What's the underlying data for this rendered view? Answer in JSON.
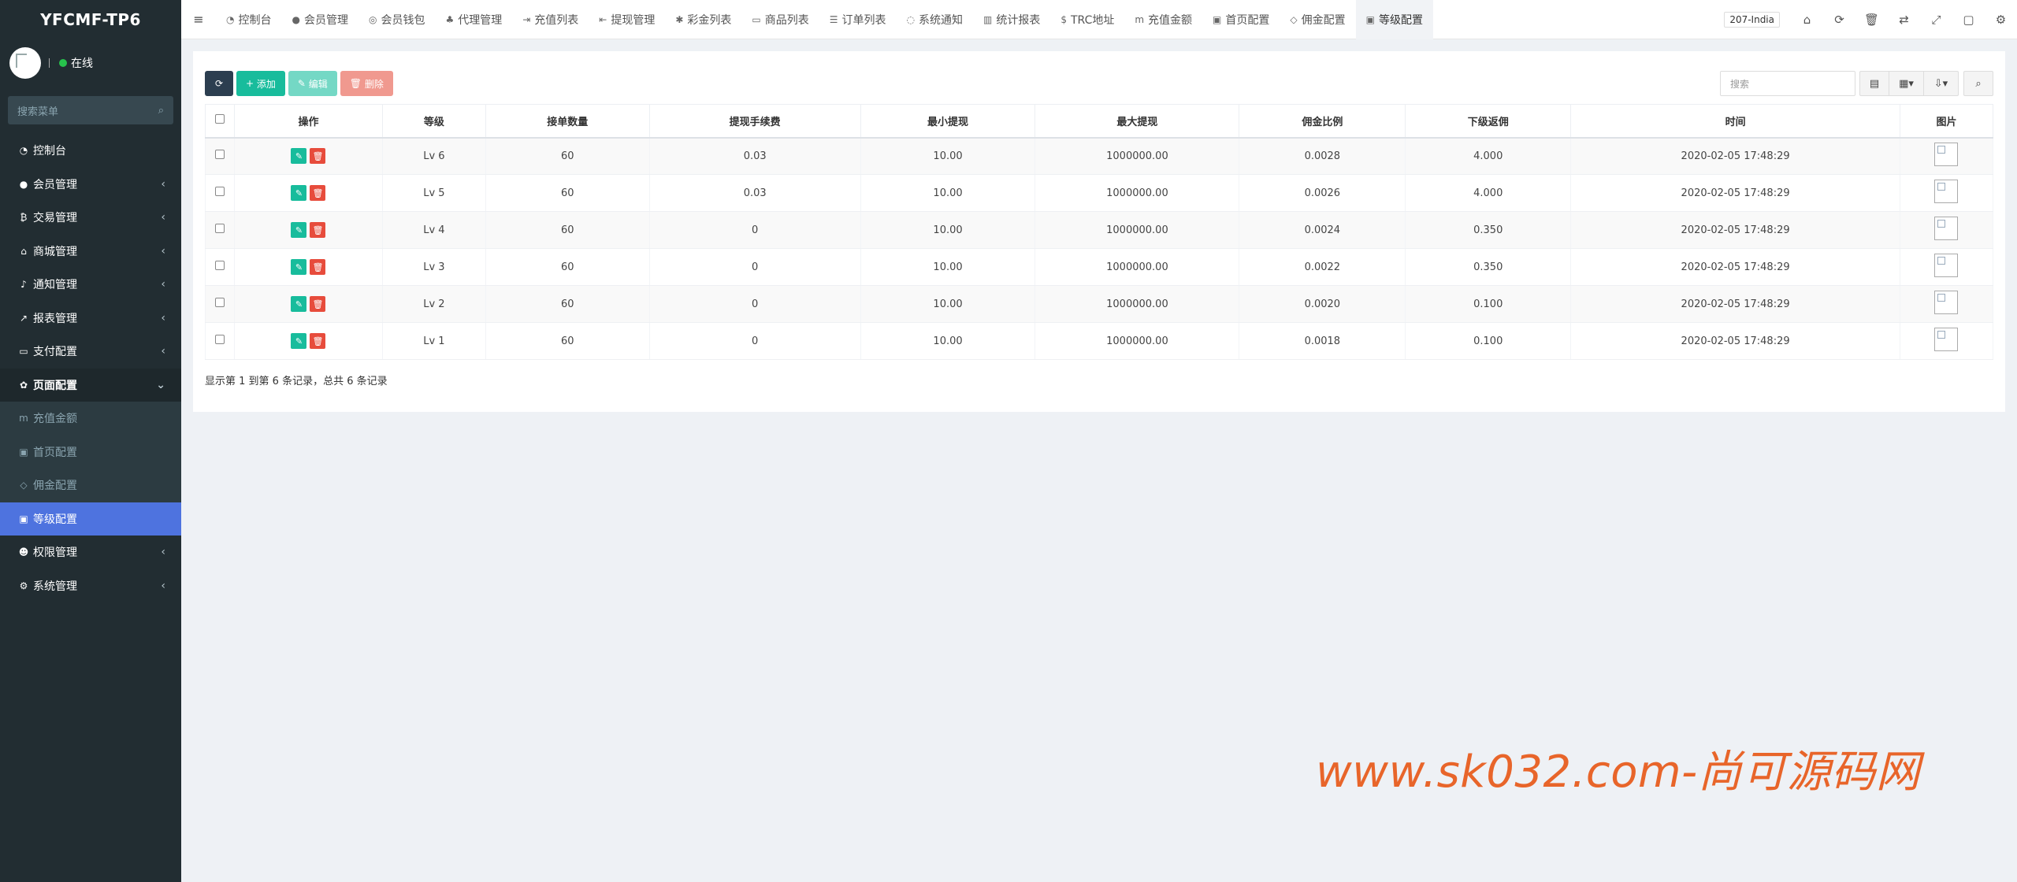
{
  "brand": "YFCMF-TP6",
  "user": {
    "status": "在线"
  },
  "sidebar": {
    "search_placeholder": "搜索菜单",
    "items": [
      {
        "label": "控制台",
        "icon": "dashboard-icon",
        "glyph": "◔",
        "chevron": ""
      },
      {
        "label": "会员管理",
        "icon": "user-circle-icon",
        "glyph": "●",
        "chevron": "‹"
      },
      {
        "label": "交易管理",
        "icon": "bitcoin-icon",
        "glyph": "₿",
        "chevron": "‹"
      },
      {
        "label": "商城管理",
        "icon": "home-icon",
        "glyph": "⌂",
        "chevron": "‹"
      },
      {
        "label": "通知管理",
        "icon": "bell-icon",
        "glyph": "♪",
        "chevron": "‹"
      },
      {
        "label": "报表管理",
        "icon": "line-chart-icon",
        "glyph": "↗",
        "chevron": "‹"
      },
      {
        "label": "支付配置",
        "icon": "credit-card-icon",
        "glyph": "▭",
        "chevron": "‹"
      },
      {
        "label": "页面配置",
        "icon": "gear-icon",
        "glyph": "✿",
        "chevron": "⌄"
      },
      {
        "label": "充值金额",
        "icon": "m-icon",
        "glyph": "m",
        "chevron": ""
      },
      {
        "label": "首页配置",
        "icon": "window-icon",
        "glyph": "▣",
        "chevron": ""
      },
      {
        "label": "佣金配置",
        "icon": "diamond-icon",
        "glyph": "◇",
        "chevron": ""
      },
      {
        "label": "等级配置",
        "icon": "vimeo-icon",
        "glyph": "▣",
        "chevron": ""
      },
      {
        "label": "权限管理",
        "icon": "users-icon",
        "glyph": "☻",
        "chevron": "‹"
      },
      {
        "label": "系统管理",
        "icon": "cogs-icon",
        "glyph": "⚙",
        "chevron": "‹"
      }
    ]
  },
  "topnav": {
    "tabs": [
      {
        "label": "控制台",
        "icon": "dashboard-icon",
        "glyph": "◔"
      },
      {
        "label": "会员管理",
        "icon": "user-icon",
        "glyph": "●"
      },
      {
        "label": "会员钱包",
        "icon": "wallet-icon",
        "glyph": "◎"
      },
      {
        "label": "代理管理",
        "icon": "sitemap-icon",
        "glyph": "♣"
      },
      {
        "label": "充值列表",
        "icon": "sign-in-icon",
        "glyph": "⇥"
      },
      {
        "label": "提现管理",
        "icon": "sign-out-icon",
        "glyph": "⇤"
      },
      {
        "label": "彩金列表",
        "icon": "gift-icon",
        "glyph": "✱"
      },
      {
        "label": "商品列表",
        "icon": "desktop-icon",
        "glyph": "▭"
      },
      {
        "label": "订单列表",
        "icon": "list-icon",
        "glyph": "☰"
      },
      {
        "label": "系统通知",
        "icon": "comments-icon",
        "glyph": "◌"
      },
      {
        "label": "统计报表",
        "icon": "bar-chart-icon",
        "glyph": "▥"
      },
      {
        "label": "TRC地址",
        "icon": "dollar-icon",
        "glyph": "$"
      },
      {
        "label": "充值金额",
        "icon": "m-icon",
        "glyph": "m"
      },
      {
        "label": "首页配置",
        "icon": "window-icon",
        "glyph": "▣"
      },
      {
        "label": "佣金配置",
        "icon": "diamond-icon",
        "glyph": "◇"
      },
      {
        "label": "等级配置",
        "icon": "vimeo-icon",
        "glyph": "▣"
      }
    ],
    "lang": "207-India"
  },
  "toolbar": {
    "add": "添加",
    "edit": "编辑",
    "delete": "删除",
    "search_placeholder": "搜索"
  },
  "table": {
    "columns": [
      "操作",
      "等级",
      "接单数量",
      "提现手续费",
      "最小提现",
      "最大提现",
      "佣金比例",
      "下级返佣",
      "时间",
      "图片"
    ],
    "rows": [
      [
        "Lv 6",
        "60",
        "0.03",
        "10.00",
        "1000000.00",
        "0.0028",
        "4.000",
        "2020-02-05 17:48:29"
      ],
      [
        "Lv 5",
        "60",
        "0.03",
        "10.00",
        "1000000.00",
        "0.0026",
        "4.000",
        "2020-02-05 17:48:29"
      ],
      [
        "Lv 4",
        "60",
        "0",
        "10.00",
        "1000000.00",
        "0.0024",
        "0.350",
        "2020-02-05 17:48:29"
      ],
      [
        "Lv 3",
        "60",
        "0",
        "10.00",
        "1000000.00",
        "0.0022",
        "0.350",
        "2020-02-05 17:48:29"
      ],
      [
        "Lv 2",
        "60",
        "0",
        "10.00",
        "1000000.00",
        "0.0020",
        "0.100",
        "2020-02-05 17:48:29"
      ],
      [
        "Lv 1",
        "60",
        "0",
        "10.00",
        "1000000.00",
        "0.0018",
        "0.100",
        "2020-02-05 17:48:29"
      ]
    ]
  },
  "pagination_info": "显示第 1 到第 6 条记录，总共 6 条记录",
  "watermark": "www.sk032.com-尚可源码网"
}
